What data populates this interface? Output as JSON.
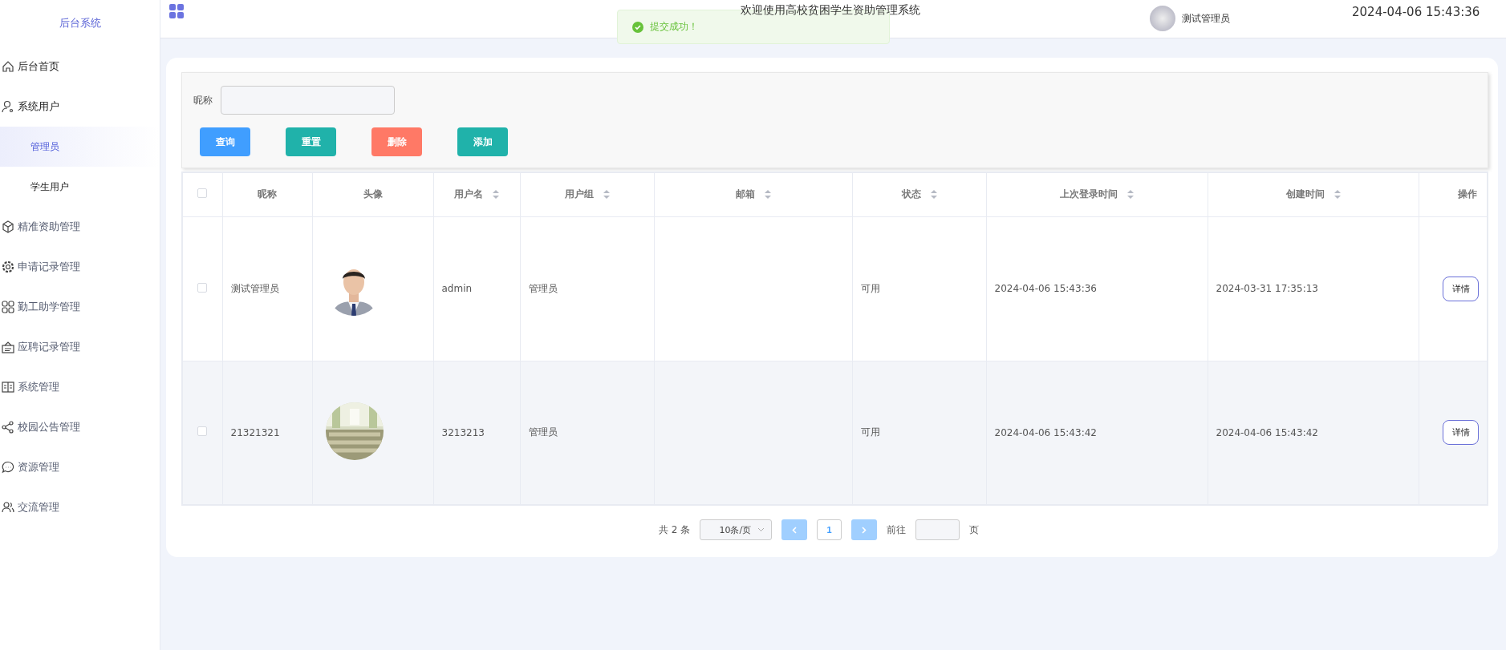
{
  "sidebar": {
    "logo": "后台系统",
    "items": [
      {
        "label": "后台首页",
        "selected": false
      },
      {
        "label": "系统用户",
        "selected": false,
        "children": [
          {
            "label": "管理员",
            "selected": true
          },
          {
            "label": "学生用户",
            "selected": false
          }
        ]
      },
      {
        "label": "精准资助管理",
        "selected": false
      },
      {
        "label": "申请记录管理",
        "selected": false
      },
      {
        "label": "勤工助学管理",
        "selected": false
      },
      {
        "label": "应聘记录管理",
        "selected": false
      },
      {
        "label": "系统管理",
        "selected": false
      },
      {
        "label": "校园公告管理",
        "selected": false
      },
      {
        "label": "资源管理",
        "selected": false
      },
      {
        "label": "交流管理",
        "selected": false
      }
    ]
  },
  "header": {
    "title": "欢迎使用高校贫困学生资助管理系统",
    "user": "测试管理员",
    "datetime": "2024-04-06 15:43:36"
  },
  "toast": {
    "message": "提交成功！"
  },
  "search": {
    "label": "昵称"
  },
  "buttons": [
    {
      "label": "查询",
      "color": "#409eff"
    },
    {
      "label": "重置",
      "color": "#20b2aa"
    },
    {
      "label": "删除",
      "color": "#ff7966"
    },
    {
      "label": "添加",
      "color": "#20b2aa"
    }
  ],
  "table": {
    "select_all": {
      "checked": false
    },
    "columns": [
      {
        "label": "昵称",
        "sortable": false
      },
      {
        "label": "头像",
        "sortable": false
      },
      {
        "label": "用户名",
        "sortable": true
      },
      {
        "label": "用户组",
        "sortable": true
      },
      {
        "label": "邮箱",
        "sortable": true
      },
      {
        "label": "状态",
        "sortable": true
      },
      {
        "label": "上次登录时间",
        "sortable": true
      },
      {
        "label": "创建时间",
        "sortable": true
      },
      {
        "label": "操作",
        "sortable": false
      }
    ],
    "rows": [
      {
        "checked": false,
        "hovered": false,
        "nickname": "测试管理员",
        "username": "admin",
        "group": "管理员",
        "status": "可用",
        "last_login": "2024-04-06 15:43:36",
        "created": "2024-03-31 17:35:13",
        "action": "详情"
      },
      {
        "checked": false,
        "hovered": true,
        "nickname": "21321321",
        "username": "3213213",
        "group": "管理员",
        "status": "可用",
        "last_login": "2024-04-06 15:43:42",
        "created": "2024-04-06 15:43:42",
        "action": "详情"
      }
    ]
  },
  "pagination": {
    "total": "共 2 条",
    "page_size": "10条/页",
    "pages": [
      {
        "label": "1",
        "selected": true
      }
    ],
    "goto": "前往",
    "page_unit": "页"
  }
}
